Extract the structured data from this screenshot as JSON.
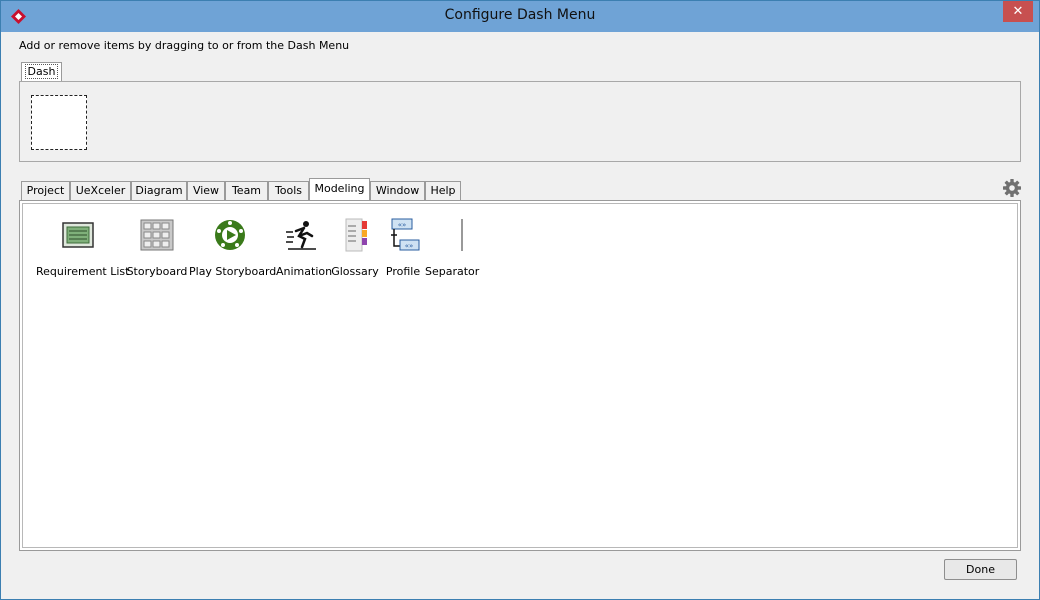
{
  "window": {
    "title": "Configure Dash Menu",
    "close_label": "✕"
  },
  "instructions": "Add or remove items by dragging to or from the Dash Menu",
  "dash": {
    "tab_label": "Dash"
  },
  "tabs": [
    {
      "label": "Project"
    },
    {
      "label": "UeXceler"
    },
    {
      "label": "Diagram"
    },
    {
      "label": "View"
    },
    {
      "label": "Team"
    },
    {
      "label": "Tools"
    },
    {
      "label": "Modeling",
      "active": true
    },
    {
      "label": "Window"
    },
    {
      "label": "Help"
    }
  ],
  "items": [
    {
      "label": "Requirement List",
      "icon": "requirement-list-icon"
    },
    {
      "label": "Storyboard",
      "icon": "storyboard-icon"
    },
    {
      "label": "Play Storyboard",
      "icon": "play-storyboard-icon"
    },
    {
      "label": "Animation",
      "icon": "animation-icon"
    },
    {
      "label": "Glossary",
      "icon": "glossary-icon"
    },
    {
      "label": "Profile",
      "icon": "profile-icon"
    },
    {
      "label": "Separator",
      "icon": "separator-icon"
    }
  ],
  "footer": {
    "done_label": "Done"
  },
  "colors": {
    "titlebar": "#6fa3d6",
    "close": "#c75050",
    "play_green": "#3a7a1a"
  }
}
